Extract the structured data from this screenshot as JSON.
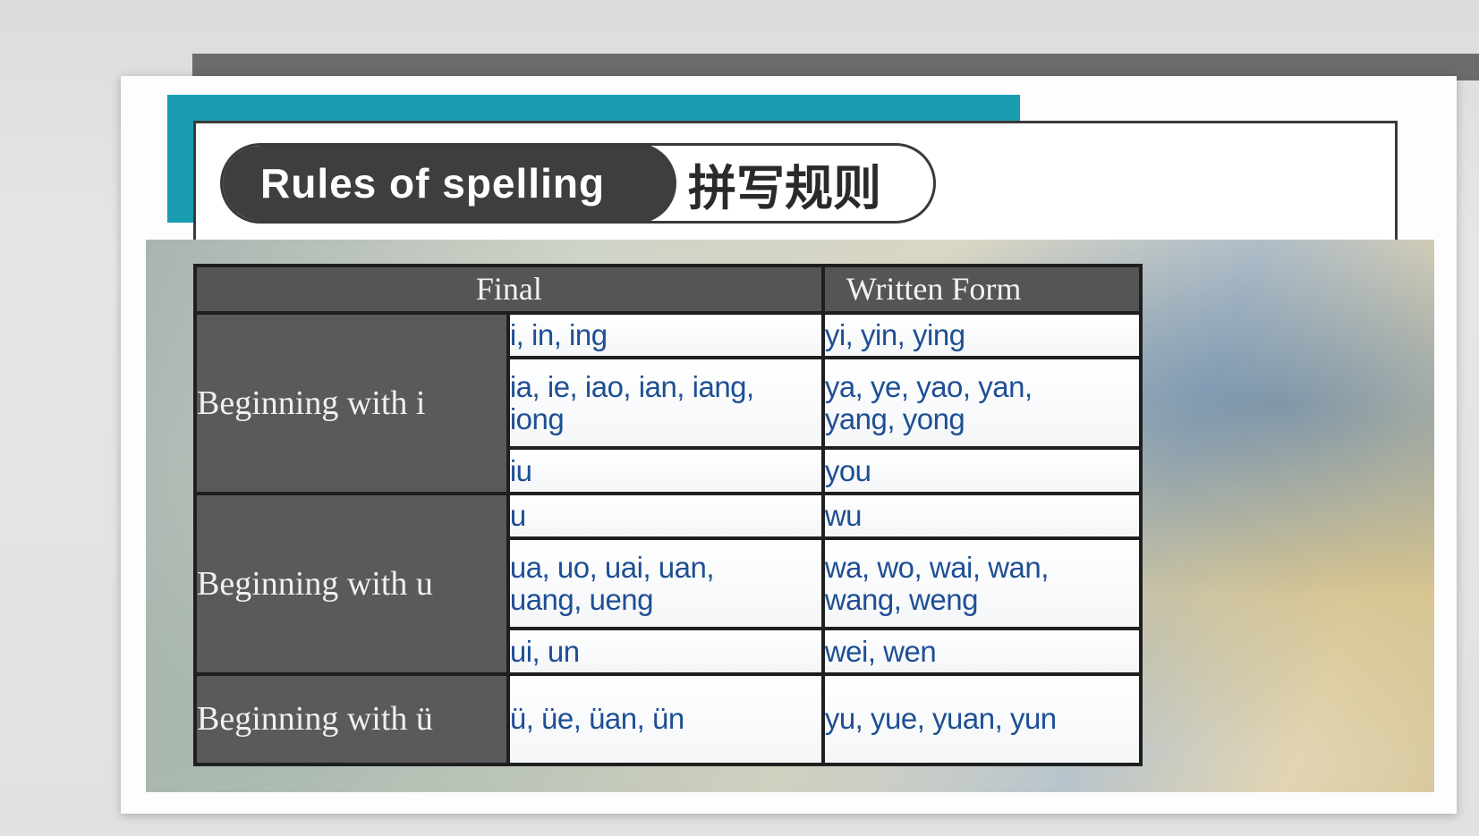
{
  "slide": {
    "title_en": "Rules of spelling",
    "title_cn": "拼写规则"
  },
  "table": {
    "headers": {
      "final": "Final",
      "written": "Written Form"
    },
    "groups": [
      {
        "label": "Beginning with i",
        "rows": [
          {
            "final": "i, in, ing",
            "written": "yi, yin, ying"
          },
          {
            "final": "ia, ie, iao, ian, iang, iong",
            "written": "ya, ye, yao, yan, yang, yong"
          },
          {
            "final": "iu",
            "written": "you"
          }
        ]
      },
      {
        "label": "Beginning with u",
        "rows": [
          {
            "final": "u",
            "written": "wu"
          },
          {
            "final": "ua, uo, uai, uan, uang, ueng",
            "written": "wa, wo, wai, wan, wang, weng"
          },
          {
            "final": "ui, un",
            "written": "wei, wen"
          }
        ]
      },
      {
        "label": "Beginning with ü",
        "rows": [
          {
            "final": "ü, üe, üan, ün",
            "written": "yu, yue, yuan, yun"
          }
        ]
      }
    ]
  },
  "colors": {
    "accent_teal": "#1a9db1",
    "header_dark": "#3e3e3e",
    "cell_text_blue": "#1e4f94"
  }
}
